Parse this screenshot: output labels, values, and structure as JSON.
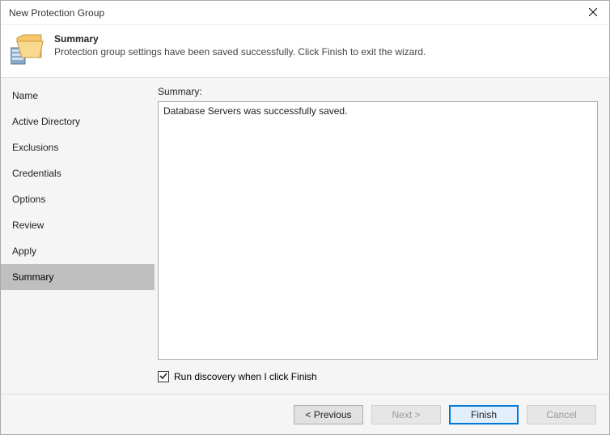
{
  "window": {
    "title": "New Protection Group"
  },
  "header": {
    "title": "Summary",
    "description": "Protection group settings have been saved successfully. Click Finish to exit the wizard."
  },
  "sidebar": {
    "items": [
      {
        "label": "Name"
      },
      {
        "label": "Active Directory"
      },
      {
        "label": "Exclusions"
      },
      {
        "label": "Credentials"
      },
      {
        "label": "Options"
      },
      {
        "label": "Review"
      },
      {
        "label": "Apply"
      },
      {
        "label": "Summary"
      }
    ]
  },
  "main": {
    "summary_label": "Summary:",
    "summary_text": "Database Servers was successfully saved.",
    "checkbox_label": "Run discovery when I click Finish",
    "checkbox_checked": true
  },
  "footer": {
    "previous": "< Previous",
    "next": "Next >",
    "finish": "Finish",
    "cancel": "Cancel"
  }
}
